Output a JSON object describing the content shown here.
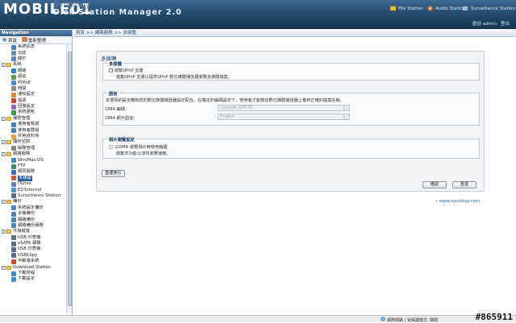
{
  "header": {
    "brand": "MOBILE01",
    "product_ghost": "Synology",
    "product": "Disk Station Manager 2.0",
    "links": [
      "File Station",
      "Audio Station",
      "Surveillance Station"
    ],
    "welcome": "歡迎 admin",
    "logout": "登出"
  },
  "sidebar": {
    "title": "Navigation",
    "home": "首頁",
    "refresh": "重新整理",
    "items": [
      {
        "label": "系統訊息",
        "level": 1,
        "color": "#4a7fc1"
      },
      {
        "label": "日誌",
        "level": 1,
        "color": "#6a8fb0"
      },
      {
        "label": "關於",
        "level": 1,
        "color": "#5c86b8"
      },
      {
        "label": "系統",
        "level": 0
      },
      {
        "label": "網路",
        "level": 1,
        "color": "#3b7dc4"
      },
      {
        "label": "語言",
        "level": 1,
        "color": "#5a9e4e"
      },
      {
        "label": "PPPoE",
        "level": 1,
        "color": "#4d8cc9"
      },
      {
        "label": "時間",
        "level": 1,
        "color": "#8b8b8b"
      },
      {
        "label": "通知設定",
        "level": 1,
        "color": "#d98c2b"
      },
      {
        "label": "電源",
        "level": 1,
        "color": "#c9443b"
      },
      {
        "label": "回復設定",
        "level": 1,
        "color": "#8e6bb8"
      },
      {
        "label": "系統更新",
        "level": 1,
        "color": "#3f9a5a"
      },
      {
        "label": "權限管理",
        "level": 0
      },
      {
        "label": "使用者帳號",
        "level": 1,
        "color": "#4b7cb8"
      },
      {
        "label": "使用者群組",
        "level": 1,
        "color": "#4b7cb8"
      },
      {
        "label": "共用資料夾",
        "level": 1,
        "color": "#e0a93a"
      },
      {
        "label": "儲存空間",
        "level": 0
      },
      {
        "label": "磁碟管理",
        "level": 1,
        "color": "#7d8a97"
      },
      {
        "label": "網路服務",
        "level": 0
      },
      {
        "label": "Win/Mac OS",
        "level": 1,
        "color": "#4a84c4"
      },
      {
        "label": "FTP",
        "level": 1,
        "color": "#3f8f5c"
      },
      {
        "label": "網頁服務",
        "level": 1,
        "color": "#3573b9"
      },
      {
        "label": "多媒體",
        "level": 1,
        "color": "#d15b3c",
        "selected": true
      },
      {
        "label": "iTunes",
        "level": 1,
        "color": "#6b7fbf"
      },
      {
        "label": "EZ-Internet",
        "level": 1,
        "color": "#3d9bd2"
      },
      {
        "label": "Surveillance Station",
        "level": 1,
        "color": "#5a6c80"
      },
      {
        "label": "備份",
        "level": 0
      },
      {
        "label": "系統設定備份",
        "level": 1,
        "color": "#4f83bd"
      },
      {
        "label": "本機備份",
        "level": 1,
        "color": "#4f83bd"
      },
      {
        "label": "網路備份",
        "level": 1,
        "color": "#4f83bd"
      },
      {
        "label": "網路備份服務",
        "level": 1,
        "color": "#4f83bd"
      },
      {
        "label": "外接裝置",
        "level": 0
      },
      {
        "label": "USB 印表機",
        "level": 1,
        "color": "#5c6f82"
      },
      {
        "label": "eSATA 硬碟",
        "level": 1,
        "color": "#5c6f82"
      },
      {
        "label": "USB 印表機",
        "level": 1,
        "color": "#5c6f82"
      },
      {
        "label": "USBCopy",
        "level": 1,
        "color": "#5c6f82"
      },
      {
        "label": "不斷電系統",
        "level": 1,
        "color": "#c94b3a"
      },
      {
        "label": "Download Station",
        "level": 0
      },
      {
        "label": "下載排程",
        "level": 1,
        "color": "#3f8fc4"
      },
      {
        "label": "下載設定",
        "level": 1,
        "color": "#3f8fc4"
      }
    ]
  },
  "breadcrumb": "首頁 >> 網路服務 >> 多媒體",
  "panel": {
    "title": "多媒體",
    "upnp": {
      "legend": "多媒體",
      "checkbox_label": "啟動UPnP 支援",
      "description": "啟動UPnP 支援以提供UPnP 數位媒體播放器瀏覽多媒體檔案。"
    },
    "language": {
      "legend": "語言",
      "description": "本選項的設定應和您的數位媒體播放器設定配合。在確定的編碼設定下，使用者才能夠在數位媒體播放器上看到正確的檔案名稱。",
      "dma_encoding_label": "DMA 編碼：",
      "dma_encoding_value": "Unicode (UTF-8)",
      "dma_language_label": "DMA 顯示語言：",
      "dma_language_value": "English"
    },
    "thumbnail": {
      "legend": "相片瀏覽設定",
      "checkbox_label": "以DMA 瀏覽相片時使用縮圖",
      "description": "啟動本功能以加快瀏覽速度。"
    },
    "reindex_button": "重建索引",
    "ok_button": "確認",
    "reset_button": "重置"
  },
  "synology_link": "» www.synology.com",
  "statusbar": {
    "zone": "網際網路 | 受保護模式: 關閉",
    "watermark": "#865911"
  }
}
